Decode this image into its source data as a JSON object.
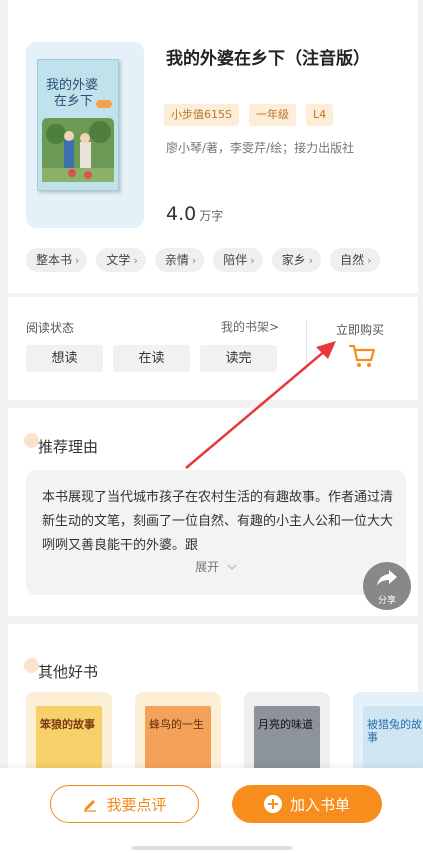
{
  "book": {
    "cover_title_line1": "我的外婆",
    "cover_title_line2": "在乡下",
    "title": "我的外婆在乡下（注音版）",
    "badges": [
      "小步值615S",
      "一年级",
      "L4"
    ],
    "authors": "廖小琴/著，李雯芹/绘；接力出版社",
    "word_count": "4.0",
    "word_unit": "万字",
    "tags": [
      "整本书",
      "文学",
      "亲情",
      "陪伴",
      "家乡",
      "自然"
    ]
  },
  "status": {
    "label": "阅读状态",
    "shelf_link": "我的书架>",
    "buttons": [
      "想读",
      "在读",
      "读完"
    ],
    "buy_label": "立即购买",
    "icon": "cart-icon"
  },
  "recommend": {
    "heading": "推荐理由",
    "text": "本书展现了当代城市孩子在农村生活的有趣故事。作者通过清新生动的文笔，刻画了一位自然、有趣的小主人公和一位大大咧咧又善良能干的外婆。跟",
    "expand_label": "展开",
    "share_label": "分享"
  },
  "others": {
    "heading": "其他好书",
    "books": [
      {
        "title": "笨狼的故事",
        "bg": "#fcefd6",
        "cover": "#f7d06a"
      },
      {
        "title": "蜂鸟的一生",
        "bg": "#fcefd6",
        "cover": "#f4a25a"
      },
      {
        "title": "月亮的味道",
        "bg": "#efefef",
        "cover": "#8d939c"
      },
      {
        "title": "被猎兔的故事",
        "bg": "#e4f1f8",
        "cover": "#cfe6f2"
      }
    ]
  },
  "bottom_bar": {
    "review_label": "我要点评",
    "add_label": "加入书单"
  },
  "colors": {
    "accent": "#f68d1c",
    "badge_bg": "#fdecd6",
    "annotation_arrow": "#e8383d"
  }
}
